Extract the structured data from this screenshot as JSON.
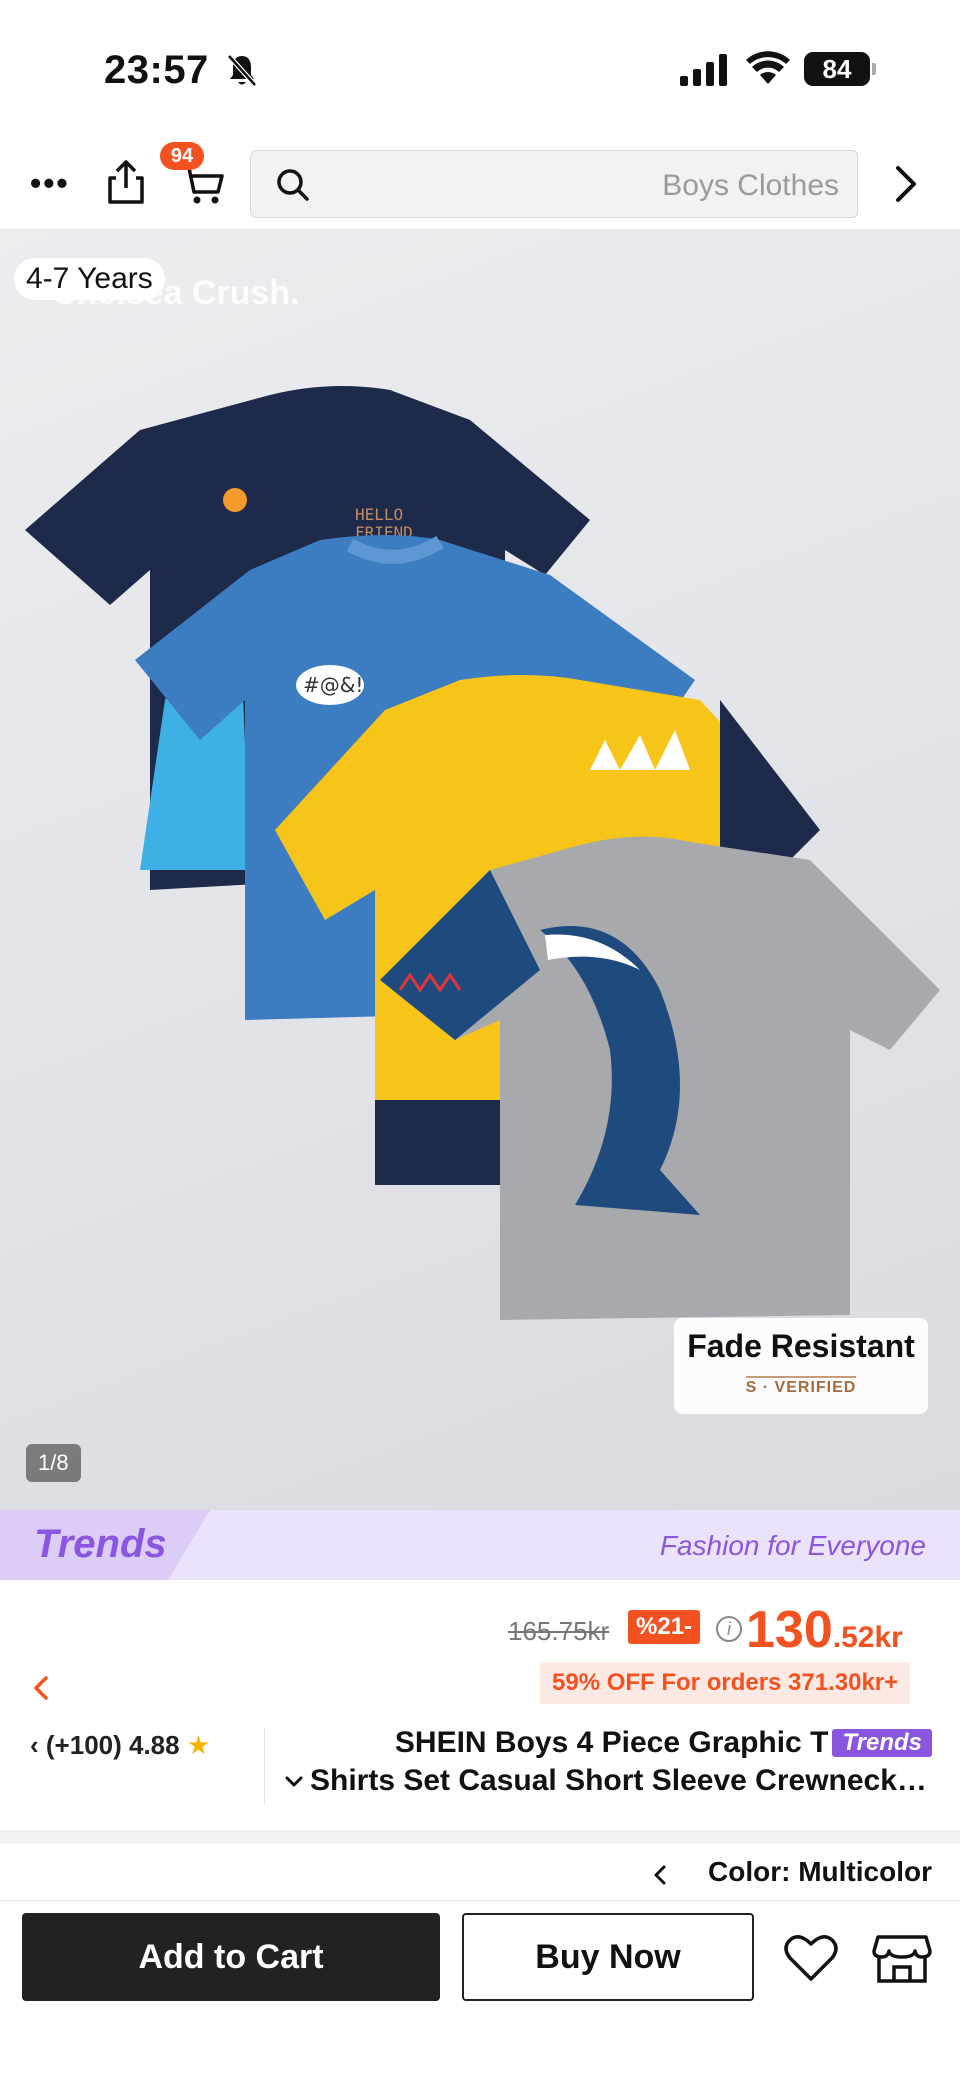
{
  "status_bar": {
    "time": "23:57",
    "battery": "84"
  },
  "nav": {
    "cart_badge": "94",
    "search_placeholder": "Boys Clothes"
  },
  "hero": {
    "age_badge": "4-7 Years",
    "watermark": "Chelsea Crush.",
    "fade_title": "Fade Resistant",
    "fade_sub": "S · VERIFIED",
    "pager": "1/8",
    "shirt_colors": [
      "#1d2a4a",
      "#3c7cc1",
      "#f7c51a",
      "#a8a9ac"
    ]
  },
  "trends_banner": {
    "logo": "Trends",
    "tagline": "Fashion for Everyone"
  },
  "price": {
    "original": "165.75kr",
    "discount": "%21-",
    "current_int": "130",
    "current_dec": ".52kr",
    "promo": "59% OFF For orders 371.30kr+"
  },
  "product": {
    "rating": "(+100) 4.88",
    "title_line1": "SHEIN Boys 4 Piece Graphic T",
    "trends_chip": "Trends",
    "title_line2": "Shirts Set Casual Short Sleeve Crewneck Tops",
    "color": "Color: Multicolor"
  },
  "actions": {
    "add_to_cart": "Add to Cart",
    "buy_now": "Buy Now"
  },
  "colors": {
    "accent": "#f3511f",
    "trends_purple": "#8a56e0",
    "dark_button": "#222222"
  }
}
